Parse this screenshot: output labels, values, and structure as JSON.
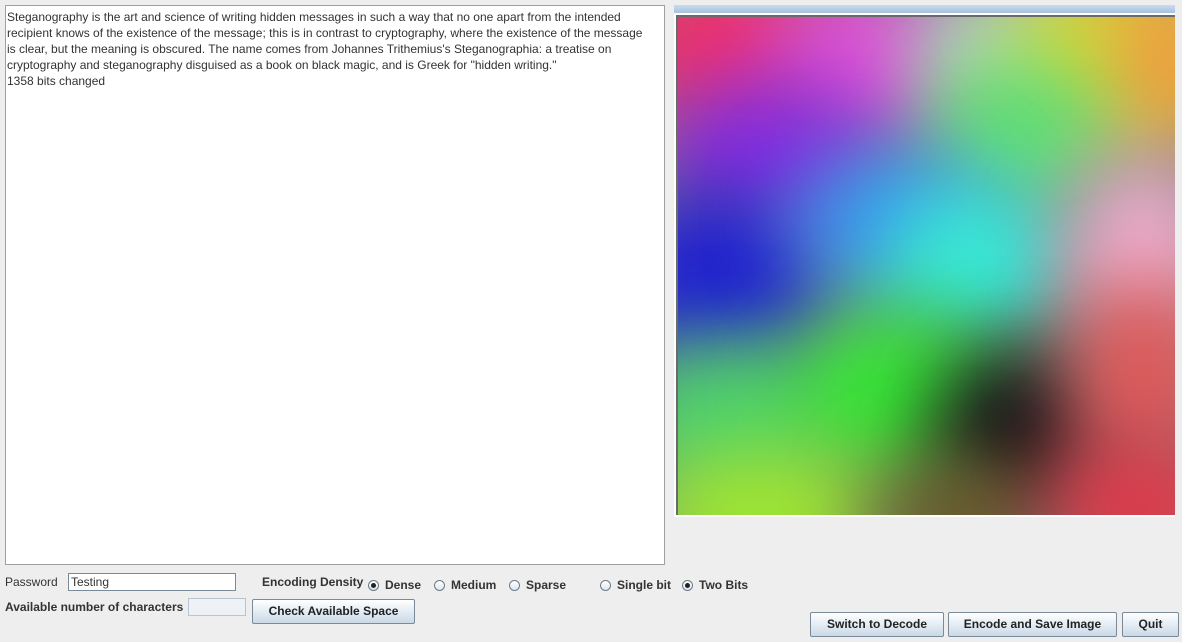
{
  "message": {
    "text": "Steganography is the art and science of writing hidden messages in such a way that no one apart from the intended\nrecipient knows of the existence of the message; this is in contrast to cryptography, where the existence of the message\nis clear, but the meaning is obscured. The name comes from Johannes Trithemius's Steganographia: a treatise on\ncryptography and steganography disguised as a book on black magic, and is Greek for \"hidden writing.\"\n1358 bits changed"
  },
  "controls": {
    "password_label": "Password",
    "password_value": "Testing",
    "available_label": "Available number of characters",
    "available_value": "",
    "check_button": "Check Available Space",
    "density_label": "Encoding Density",
    "density_options": [
      {
        "label": "Dense",
        "checked": true
      },
      {
        "label": "Medium",
        "checked": false
      },
      {
        "label": "Sparse",
        "checked": false
      }
    ],
    "bits_options": [
      {
        "label": "Single bit",
        "checked": false
      },
      {
        "label": "Two Bits",
        "checked": true
      }
    ]
  },
  "actions": {
    "switch_button": "Switch to Decode",
    "encode_button": "Encode and Save Image",
    "quit_button": "Quit"
  },
  "colors": {
    "window_bg": "#eeeeee",
    "button_border": "#7a8a99",
    "text": "#333333"
  },
  "icons": {
    "radio_checked": "filled-dot",
    "radio_unchecked": "empty-circle"
  }
}
